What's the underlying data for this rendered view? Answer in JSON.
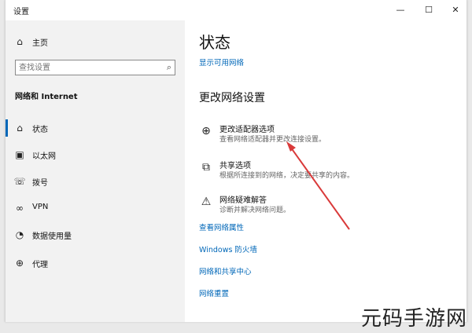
{
  "window": {
    "title": "设置",
    "minimize": "—",
    "maximize": "☐",
    "close": "✕"
  },
  "sidebar": {
    "home_label": "主页",
    "search_placeholder": "查找设置",
    "section_title": "网络和 Internet",
    "items": [
      {
        "label": "状态",
        "icon": "status-icon"
      },
      {
        "label": "以太网",
        "icon": "ethernet-icon"
      },
      {
        "label": "拨号",
        "icon": "dialup-icon"
      },
      {
        "label": "VPN",
        "icon": "vpn-icon"
      },
      {
        "label": "数据使用量",
        "icon": "data-usage-icon"
      },
      {
        "label": "代理",
        "icon": "proxy-icon"
      }
    ]
  },
  "main": {
    "title": "状态",
    "show_networks_link": "显示可用网络",
    "change_settings_heading": "更改网络设置",
    "options": [
      {
        "title": "更改适配器选项",
        "desc": "查看网络适配器并更改连接设置。",
        "icon": "adapter-icon"
      },
      {
        "title": "共享选项",
        "desc": "根据所连接到的网络，决定要共享的内容。",
        "icon": "sharing-icon"
      },
      {
        "title": "网络疑难解答",
        "desc": "诊断并解决网络问题。",
        "icon": "troubleshoot-icon"
      }
    ],
    "links": [
      "查看网络属性",
      "Windows 防火墙",
      "网络和共享中心",
      "网络重置"
    ]
  },
  "watermark": "元码手游网",
  "colors": {
    "accent": "#0067b8",
    "arrow": "#d93a3a"
  }
}
